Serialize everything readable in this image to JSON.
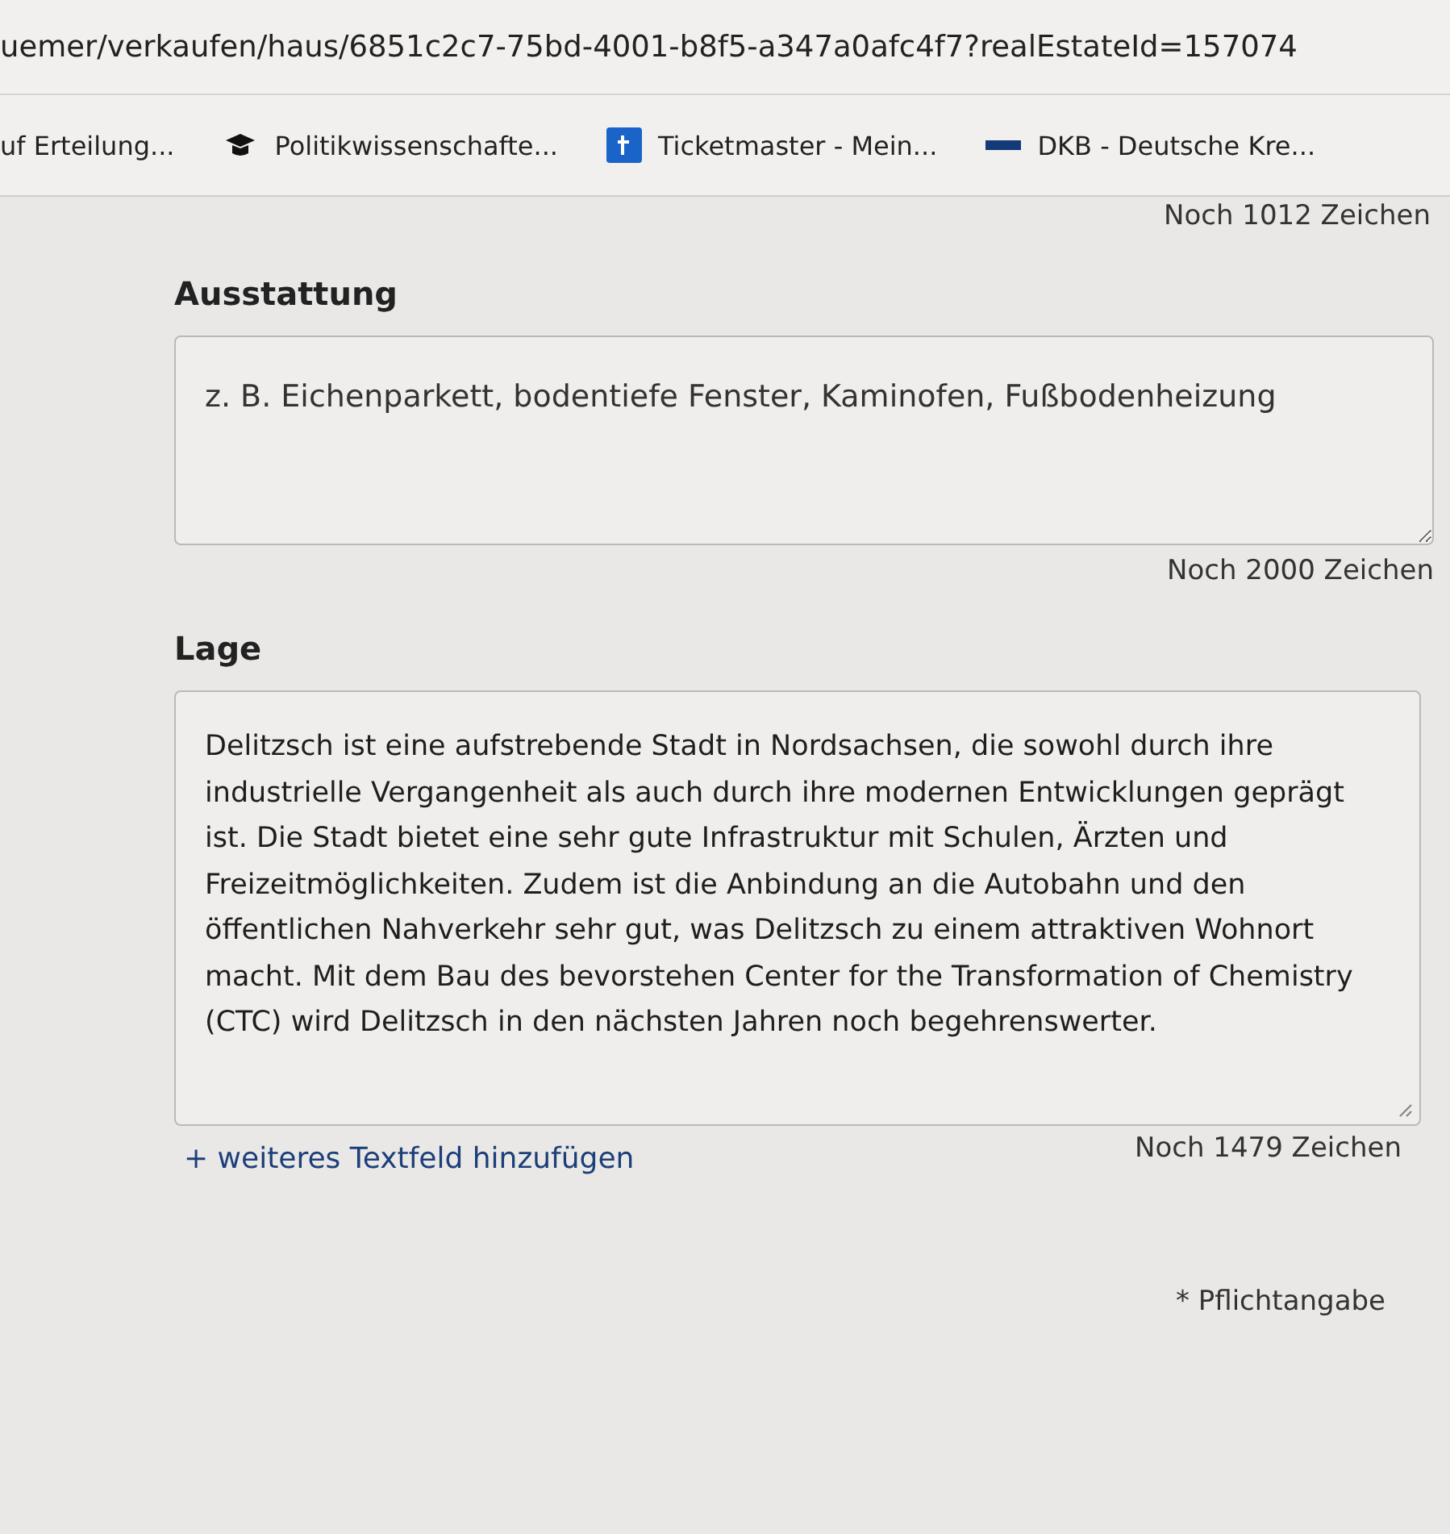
{
  "address_bar": {
    "url": "uemer/verkaufen/haus/6851c2c7-75bd-4001-b8f5-a347a0afc4f7?realEstateId=157074"
  },
  "bookmarks": [
    {
      "label": "uf Erteilung...",
      "kind": "plain"
    },
    {
      "label": "Politikwissenschafte...",
      "kind": "cap"
    },
    {
      "label": "Ticketmaster - Mein...",
      "kind": "ticket"
    },
    {
      "label": "DKB - Deutsche Kre...",
      "kind": "bank"
    }
  ],
  "top_counter": "Noch 1012 Zeichen",
  "fields": [
    {
      "label": "Ausstattung",
      "placeholder": "z. B. Eichenparkett, bodentiefe Fenster, Kaminofen, Fußbodenheizung",
      "counter": "Noch 2000 Zeichen"
    },
    {
      "label": "Lage",
      "value": "Delitzsch ist eine aufstrebende Stadt in Nordsachsen, die sowohl durch ihre industrielle Vergangenheit als auch durch ihre modernen Entwicklungen geprägt ist. Die Stadt bietet eine sehr gute Infrastruktur mit Schulen, Ärzten und Freizeitmöglichkeiten. Zudem ist die Anbindung an die Autobahn und den öffentlichen Nahverkehr sehr gut, was Delitzsch zu einem attraktiven Wohnort macht. Mit dem Bau des bevorstehen Center for the Transformation of Chemistry (CTC) wird Delitzsch in den nächsten Jahren noch begehrenswerter.",
      "counter": "Noch 1479 Zeichen"
    }
  ],
  "add_link": "+ weiteres Textfeld hinzufügen",
  "required_note": "* Pflichtangabe"
}
